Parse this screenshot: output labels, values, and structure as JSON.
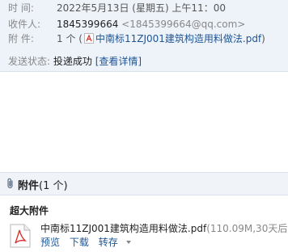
{
  "header": {
    "time_label": "时 间:",
    "time_value": "2022年5月13日 (星期五) 上午11：00",
    "recipient_label": "收件人:",
    "recipient_name": "1845399664",
    "recipient_email": "<1845399664@qq.com>",
    "attachment_label": "附 件:",
    "attachment_count": "1 个 (",
    "attachment_name": "中南标11ZJ001建筑构造用料做法.pdf",
    "attachment_close": ")"
  },
  "status": {
    "label": "发送状态:",
    "value": "投递成功",
    "detail_link": "[查看详情]"
  },
  "attachments": {
    "title": "附件",
    "count": "(1 个)",
    "section_title": "超大附件",
    "file_name": "中南标11ZJ001建筑构造用料做法.pdf",
    "file_meta": "(110.09M,30天后",
    "preview_label": "预览",
    "download_label": "下载",
    "save_label": "转存"
  },
  "colors": {
    "header_bg": "#eef3fa",
    "link": "#1e5494",
    "pdf_red": "#d9302c"
  },
  "icons": {
    "pdf": "pdf-file-icon",
    "clip": "paperclip-icon",
    "caret": "chevron-down-icon"
  }
}
